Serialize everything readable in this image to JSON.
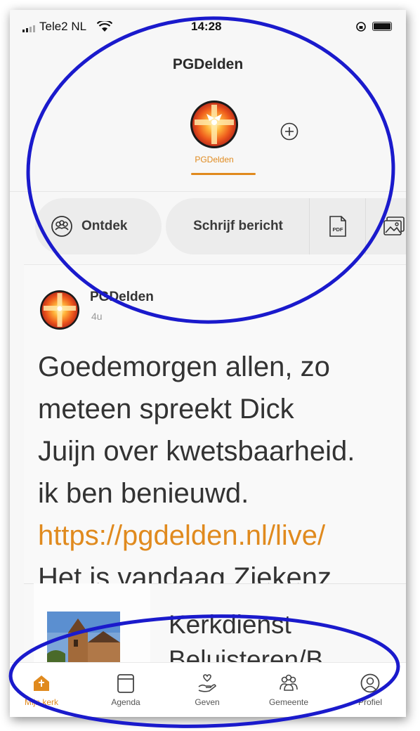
{
  "status_bar": {
    "carrier": "Tele2 NL",
    "time": "14:28"
  },
  "header": {
    "title": "PGDelden",
    "church_tab_label": "PGDelden"
  },
  "actions": {
    "discover_label": "Ontdek",
    "write_label": "Schrijf bericht",
    "pdf_label": "PDF"
  },
  "post": {
    "author": "PGDelden",
    "time": "4u",
    "lines": [
      "Goedemorgen allen, zo",
      "meteen spreekt Dick",
      "Juijn over kwetsbaarheid.",
      "ik ben benieuwd."
    ],
    "link": "https://pgdelden.nl/live/",
    "last_line": "Het is vandaag Ziekenz..."
  },
  "second_card": {
    "title_lines": [
      "Kerkdienst",
      "Beluisteren/B"
    ]
  },
  "nav": [
    {
      "label": "Mijn kerk"
    },
    {
      "label": "Agenda"
    },
    {
      "label": "Geven"
    },
    {
      "label": "Gemeente"
    },
    {
      "label": "Profiel"
    }
  ],
  "colors": {
    "accent": "#e08a1e",
    "annotation": "#1a1acc"
  }
}
